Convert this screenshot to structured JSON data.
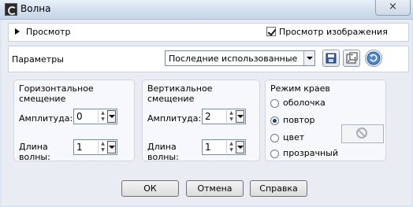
{
  "window": {
    "title": "Волна",
    "close_glyph": "×"
  },
  "preview": {
    "label": "Просмотр",
    "show_image_label": "Просмотр изображения",
    "show_image_checked": true
  },
  "params": {
    "label": "Параметры",
    "preset_value": "Последние использованные"
  },
  "horizontal": {
    "title": "Горизонтальное смещение",
    "amplitude_label": "Амплитуда:",
    "amplitude_value": "0",
    "wavelength_label_1": "Длина",
    "wavelength_label_2": "волны:",
    "wavelength_value": "1"
  },
  "vertical": {
    "title": "Вертикальное смещение",
    "amplitude_label": "Амплитуда:",
    "amplitude_value": "2",
    "wavelength_label_1": "Длина",
    "wavelength_label_2": "волны:",
    "wavelength_value": "1"
  },
  "edge_mode": {
    "title": "Режим краев",
    "options": [
      "оболочка",
      "повтор",
      "цвет",
      "прозрачный"
    ],
    "selected": "повтор"
  },
  "buttons": {
    "ok": "ОК",
    "cancel": "Отмена",
    "help": "Справка"
  }
}
